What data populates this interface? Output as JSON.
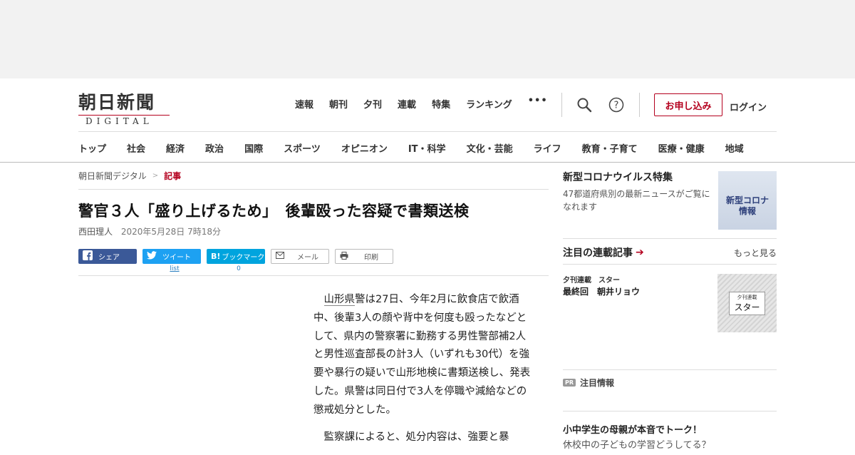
{
  "header": {
    "logo_main": "朝日新聞",
    "logo_sub": "DIGITAL",
    "topnav": [
      "速報",
      "朝刊",
      "夕刊",
      "連載",
      "特集",
      "ランキング"
    ],
    "more": "•••",
    "subscribe": "お申し込み",
    "login": "ログイン"
  },
  "catnav": [
    "トップ",
    "社会",
    "経済",
    "政治",
    "国際",
    "スポーツ",
    "オピニオン",
    "IT・科学",
    "文化・芸能",
    "ライフ",
    "教育・子育て",
    "医療・健康",
    "地域"
  ],
  "breadcrumb": {
    "home": "朝日新聞デジタル",
    "sep": ">",
    "current": "記事"
  },
  "article": {
    "headline": "警官３人「盛り上げるため」　後輩殴った容疑で書類送検",
    "author": "西田理人",
    "date": "2020年5月28日 7時18分",
    "share": {
      "facebook": "シェア",
      "twitter": "ツイート",
      "hatena": "ブックマーク",
      "hatena_logo": "B!",
      "mail": "メール",
      "print": "印刷",
      "tweet_count": "list",
      "hatena_count": "0"
    },
    "p1_kw": "山形県",
    "p1_rest": "警は27日、今年2月に飲食店で飲酒中、後輩3人の顔や背中を何度も殴ったなどとして、県内の警察署に勤務する男性警部補2人と男性巡査部長の計3人（いずれも30代）を強要や暴行の疑いで山形地検に書類送検し、発表した。県警は同日付で3人を停職や減給などの懲戒処分とした。",
    "p2": "監察課によると、処分内容は、強要と暴"
  },
  "sidebar": {
    "corona_title": "新型コロナウイルス特集",
    "corona_desc": "47都道府県別の最新ニュースがご覧になれます",
    "corona_img_line1": "新型コロナ",
    "corona_img_line2": "情報",
    "serial_head": "注目の連載記事",
    "serial_arrow": "➔",
    "more": "もっと見る",
    "serial_cat": "夕刊連載　スター",
    "serial_title": "最終回　朝井リョウ",
    "serial_img_small": "夕刊連載",
    "serial_img_big": "スター",
    "pr_badge": "PR",
    "pr_label": "注目情報",
    "promo_title": "小中学生の母親が本音でトーク！",
    "promo_desc": "休校中の子どもの学習どうしてる？"
  },
  "colors": {
    "accent": "#b4001e",
    "facebook": "#3b5998",
    "twitter": "#1da1f2",
    "hatena": "#00a4de"
  }
}
